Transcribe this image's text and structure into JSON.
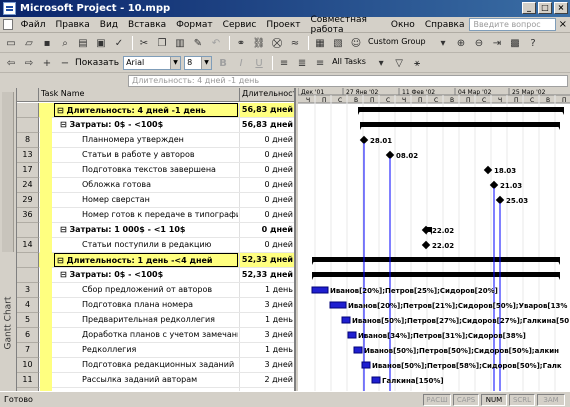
{
  "window": {
    "title": "Microsoft Project - 10.mpp",
    "minimize": "_",
    "maximize": "□",
    "close": "×"
  },
  "menu": {
    "items": [
      "Файл",
      "Правка",
      "Вид",
      "Вставка",
      "Формат",
      "Сервис",
      "Проект",
      "Совместная работа",
      "Окно",
      "Справка"
    ],
    "ask_placeholder": "Введите вопрос",
    "close": "×"
  },
  "toolbar1": {
    "group_combo": "Custom Group"
  },
  "toolbar2": {
    "show_label": "Показать",
    "font_combo": "Arial",
    "size_combo": "8",
    "filter_combo": "All Tasks"
  },
  "entry_bar": {
    "value": "Длительность: 4 дней  -1 день"
  },
  "view_bar": {
    "label": "Gantt Chart"
  },
  "grid": {
    "headers": {
      "name": "Task Name",
      "duration": "Длительность"
    },
    "rows": [
      {
        "id": "",
        "name": "⊟ Длительность: 4 дней  -1 день",
        "duration": "56,83 дней",
        "level": 0,
        "summary": true,
        "highlight": true
      },
      {
        "id": "",
        "name": "⊟ Затраты: 0$ - <100$",
        "duration": "56,83 дней",
        "level": 1,
        "summary": true
      },
      {
        "id": "8",
        "name": "Планномера утвержден",
        "duration": "0 дней",
        "level": 2
      },
      {
        "id": "13",
        "name": "Статьи в работе у авторов",
        "duration": "0 дней",
        "level": 2
      },
      {
        "id": "17",
        "name": "Подготовка текстов завершена",
        "duration": "0 дней",
        "level": 2
      },
      {
        "id": "24",
        "name": "Обложка готова",
        "duration": "0 дней",
        "level": 2
      },
      {
        "id": "29",
        "name": "Номер сверстан",
        "duration": "0 дней",
        "level": 2
      },
      {
        "id": "36",
        "name": "Номер готов к передаче в типографию",
        "duration": "0 дней",
        "level": 2
      },
      {
        "id": "",
        "name": "⊟ Затраты: 1 000$ - <1 10$",
        "duration": "0 дней",
        "level": 1,
        "summary": true
      },
      {
        "id": "14",
        "name": "Статьи поступили в редакцию",
        "duration": "0 дней",
        "level": 2
      },
      {
        "id": "",
        "name": "⊟ Длительность: 1 день  -<4 дней",
        "duration": "52,33 дней",
        "level": 0,
        "summary": true,
        "highlight": true
      },
      {
        "id": "",
        "name": "⊟ Затраты: 0$ - <100$",
        "duration": "52,33 дней",
        "level": 1,
        "summary": true
      },
      {
        "id": "3",
        "name": "Сбор предложений от авторов",
        "duration": "1 день",
        "level": 2
      },
      {
        "id": "4",
        "name": "Подготовка плана номера",
        "duration": "3 дней",
        "level": 2
      },
      {
        "id": "5",
        "name": "Предварительная редколлегия",
        "duration": "1 день",
        "level": 2
      },
      {
        "id": "6",
        "name": "Доработка планов с учетом замечаний",
        "duration": "3 дней",
        "level": 2
      },
      {
        "id": "7",
        "name": "Редколлегия",
        "duration": "1 день",
        "level": 2
      },
      {
        "id": "10",
        "name": "Подготовка редакционных заданий",
        "duration": "3 дней",
        "level": 2
      },
      {
        "id": "11",
        "name": "Рассылка заданий авторам",
        "duration": "2 дней",
        "level": 2
      },
      {
        "id": "12",
        "name": "Утверждение заданий",
        "duration": "3,33 дней",
        "level": 2
      }
    ]
  },
  "gantt": {
    "months": [
      "Дек '01",
      "27 Янв '02",
      "11 Фев '02",
      "04 Мар '02",
      "25 Мар '02"
    ],
    "day_letters": [
      "Ч",
      "П",
      "С",
      "В",
      "П",
      "С",
      "Ч",
      "П",
      "С",
      "В",
      "П",
      "С",
      "Ч",
      "П",
      "С",
      "В",
      "П"
    ],
    "milestone_labels": [
      "28.01",
      "08.02",
      "18.03",
      "21.03",
      "25.03",
      "22.02",
      "22.02"
    ],
    "resource_labels": [
      "Иванов[20%];Петров[25%];Сидоров[20%]",
      "Иванов[20%];Петров[21%];Сидоров[50%];Уваров[13%",
      "Иванов[50%];Петров[27%];Сидоров[27%];Галкина[50",
      "Иванов[34%];Петров[31%];Сидоров[38%]",
      "Иванов[50%];Петров[50%];Сидоров[50%];алкин",
      "Иванов[50%];Петров[58%];Сидоров[50%];Галк",
      "Галкина[150%]",
      "Иванов[30%];Петров[30%];Сидоров[30%];Ж"
    ]
  },
  "status": {
    "ready": "Готово",
    "indicators": [
      "РАСШ",
      "CAPS",
      "NUM",
      "SCRL",
      "ЗАМ"
    ],
    "active": [
      "NUM"
    ]
  },
  "colors": {
    "summary_bar": "#000000",
    "task_bar": "#1f1fd0",
    "highlight": "#ffff80",
    "link": "#0000ff"
  }
}
